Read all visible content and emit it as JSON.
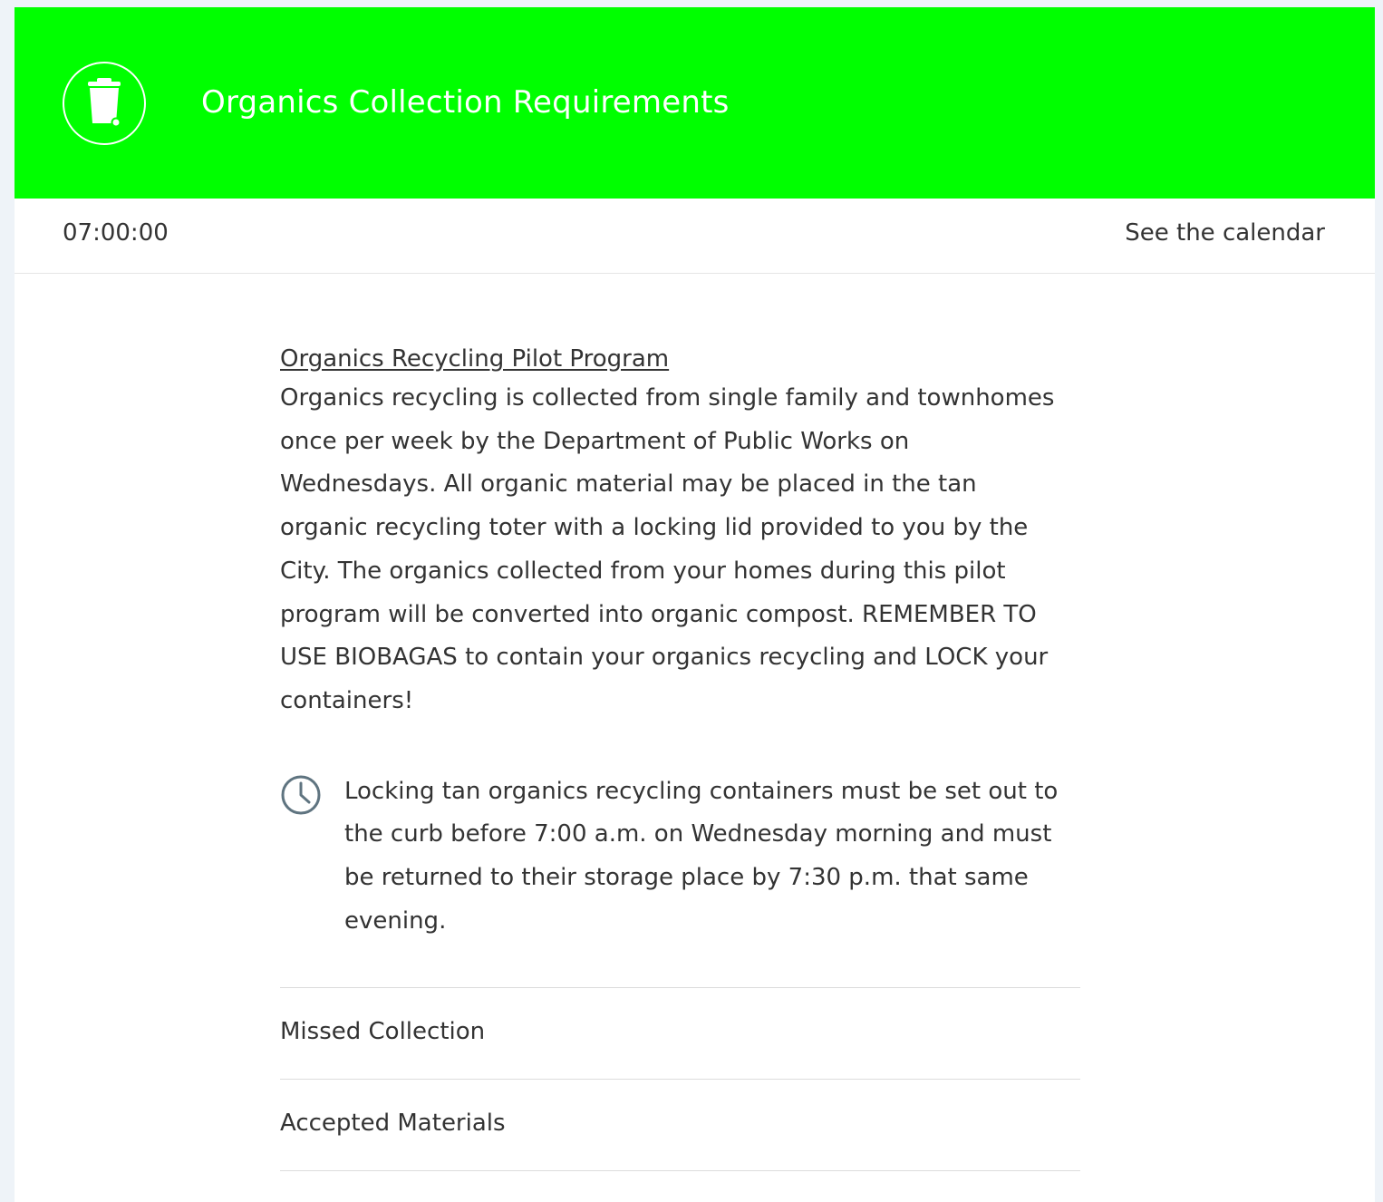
{
  "header": {
    "title": "Organics Collection Requirements",
    "icon": "trash-bin-icon",
    "background_color": "#00ff00"
  },
  "info_bar": {
    "time": "07:00:00",
    "calendar_link": "See the calendar"
  },
  "program": {
    "link_text": "Organics Recycling Pilot Program",
    "description": "Organics recycling is collected from single family and townhomes once per week by the Department of Public Works on Wednesdays. All organic material may be placed in the tan organic recycling toter with a locking lid provided to you by the City. The organics collected from your homes during this pilot program will be converted into organic compost.  REMEMBER TO USE BIOBAGAS to contain your organics recycling and LOCK your containers!"
  },
  "notice": {
    "icon": "clock-icon",
    "text": "Locking tan organics recycling containers must be set out to the curb before 7:00 a.m. on Wednesday morning and must be returned to their storage place by 7:30 p.m. that same evening."
  },
  "accordion": {
    "items": [
      {
        "label": "Missed Collection"
      },
      {
        "label": "Accepted Materials"
      }
    ]
  }
}
